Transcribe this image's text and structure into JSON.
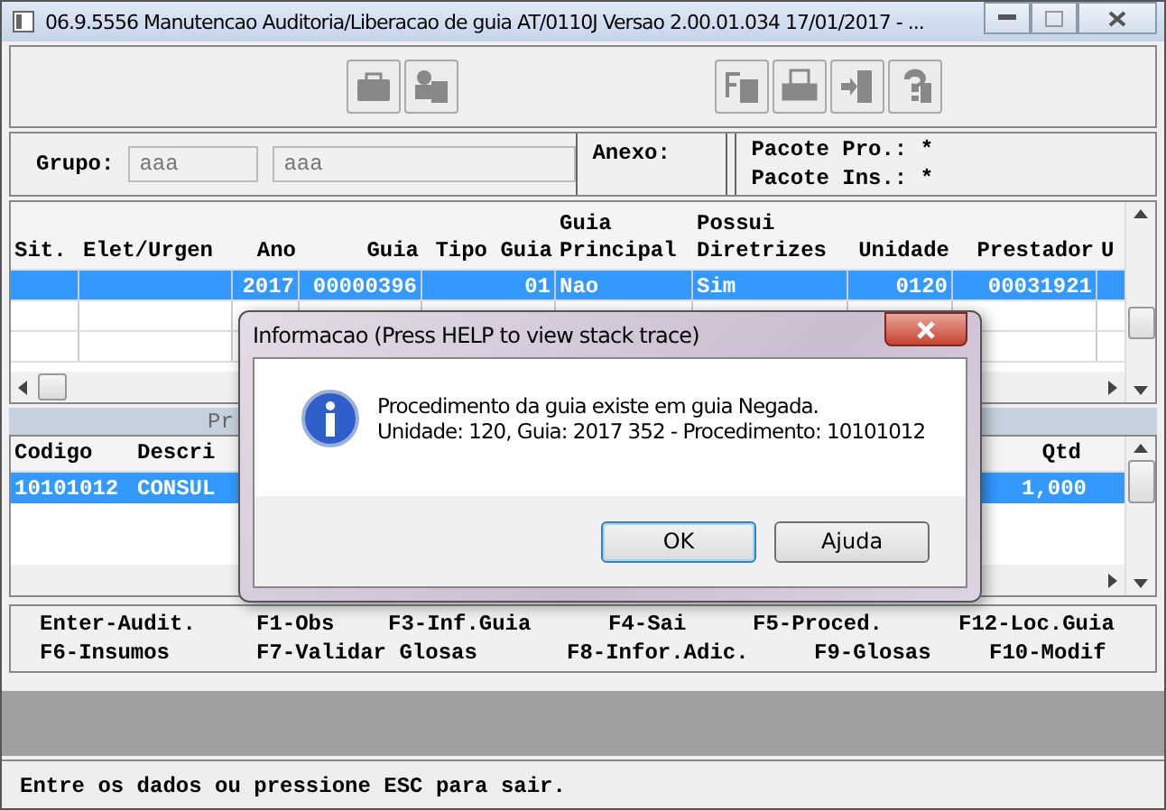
{
  "window": {
    "title": "06.9.5556 Manutencao  Auditoria/Liberacao de guia AT/0110J Versao 2.00.01.034 17/01/2017 - ..."
  },
  "filters": {
    "group_label": "Grupo:",
    "fields": [
      {
        "value": "aaa"
      },
      {
        "value": "aaa"
      }
    ],
    "anexo_label": "Anexo:",
    "pacote": [
      "Pacote Pro.: *",
      "Pacote Ins.: *"
    ]
  },
  "table": {
    "columns": [
      {
        "lines": [
          "Sit."
        ]
      },
      {
        "lines": [
          "Elet/Urgen"
        ]
      },
      {
        "lines": [
          "Ano"
        ]
      },
      {
        "lines": [
          "Guia"
        ]
      },
      {
        "lines": [
          "Tipo Guia"
        ]
      },
      {
        "lines": [
          "Guia",
          "Principal"
        ]
      },
      {
        "lines": [
          "Possui",
          "Diretrizes"
        ]
      },
      {
        "lines": [
          "Unidade"
        ]
      },
      {
        "lines": [
          "Prestador"
        ]
      },
      {
        "lines": [
          "U"
        ]
      }
    ],
    "rows": [
      {
        "selected": true,
        "cells": [
          "",
          "",
          "2017",
          "00000396",
          "01",
          "Nao",
          "Sim",
          "0120",
          "00031921",
          ""
        ]
      }
    ]
  },
  "section": {
    "title": "Pr"
  },
  "detail": {
    "columns": [
      "Codigo",
      "Descri",
      "Qtd"
    ],
    "rows": [
      {
        "selected": true,
        "cells": [
          "10101012",
          "CONSUL",
          "1,000"
        ]
      }
    ]
  },
  "shortcuts": [
    [
      "Enter-Audit.",
      "F1-Obs",
      "F3-Inf.Guia",
      "F4-Sai",
      "F5-Proced.",
      "F12-Loc.Guia"
    ],
    [
      "F6-Insumos",
      "F7-Validar Glosas",
      "F8-Infor.Adic.",
      "F9-Glosas",
      "F10-Modif"
    ]
  ],
  "status_bar": "Entre os dados ou pressione ESC para sair.",
  "dialog": {
    "title": "Informacao (Press HELP to view stack trace)",
    "message": [
      "Procedimento da guia existe em guia Negada.",
      "Unidade: 120, Guia: 2017 352 - Procedimento: 10101012"
    ],
    "buttons": [
      {
        "label": "OK",
        "default": true
      },
      {
        "label": "Ajuda",
        "default": false
      }
    ]
  }
}
